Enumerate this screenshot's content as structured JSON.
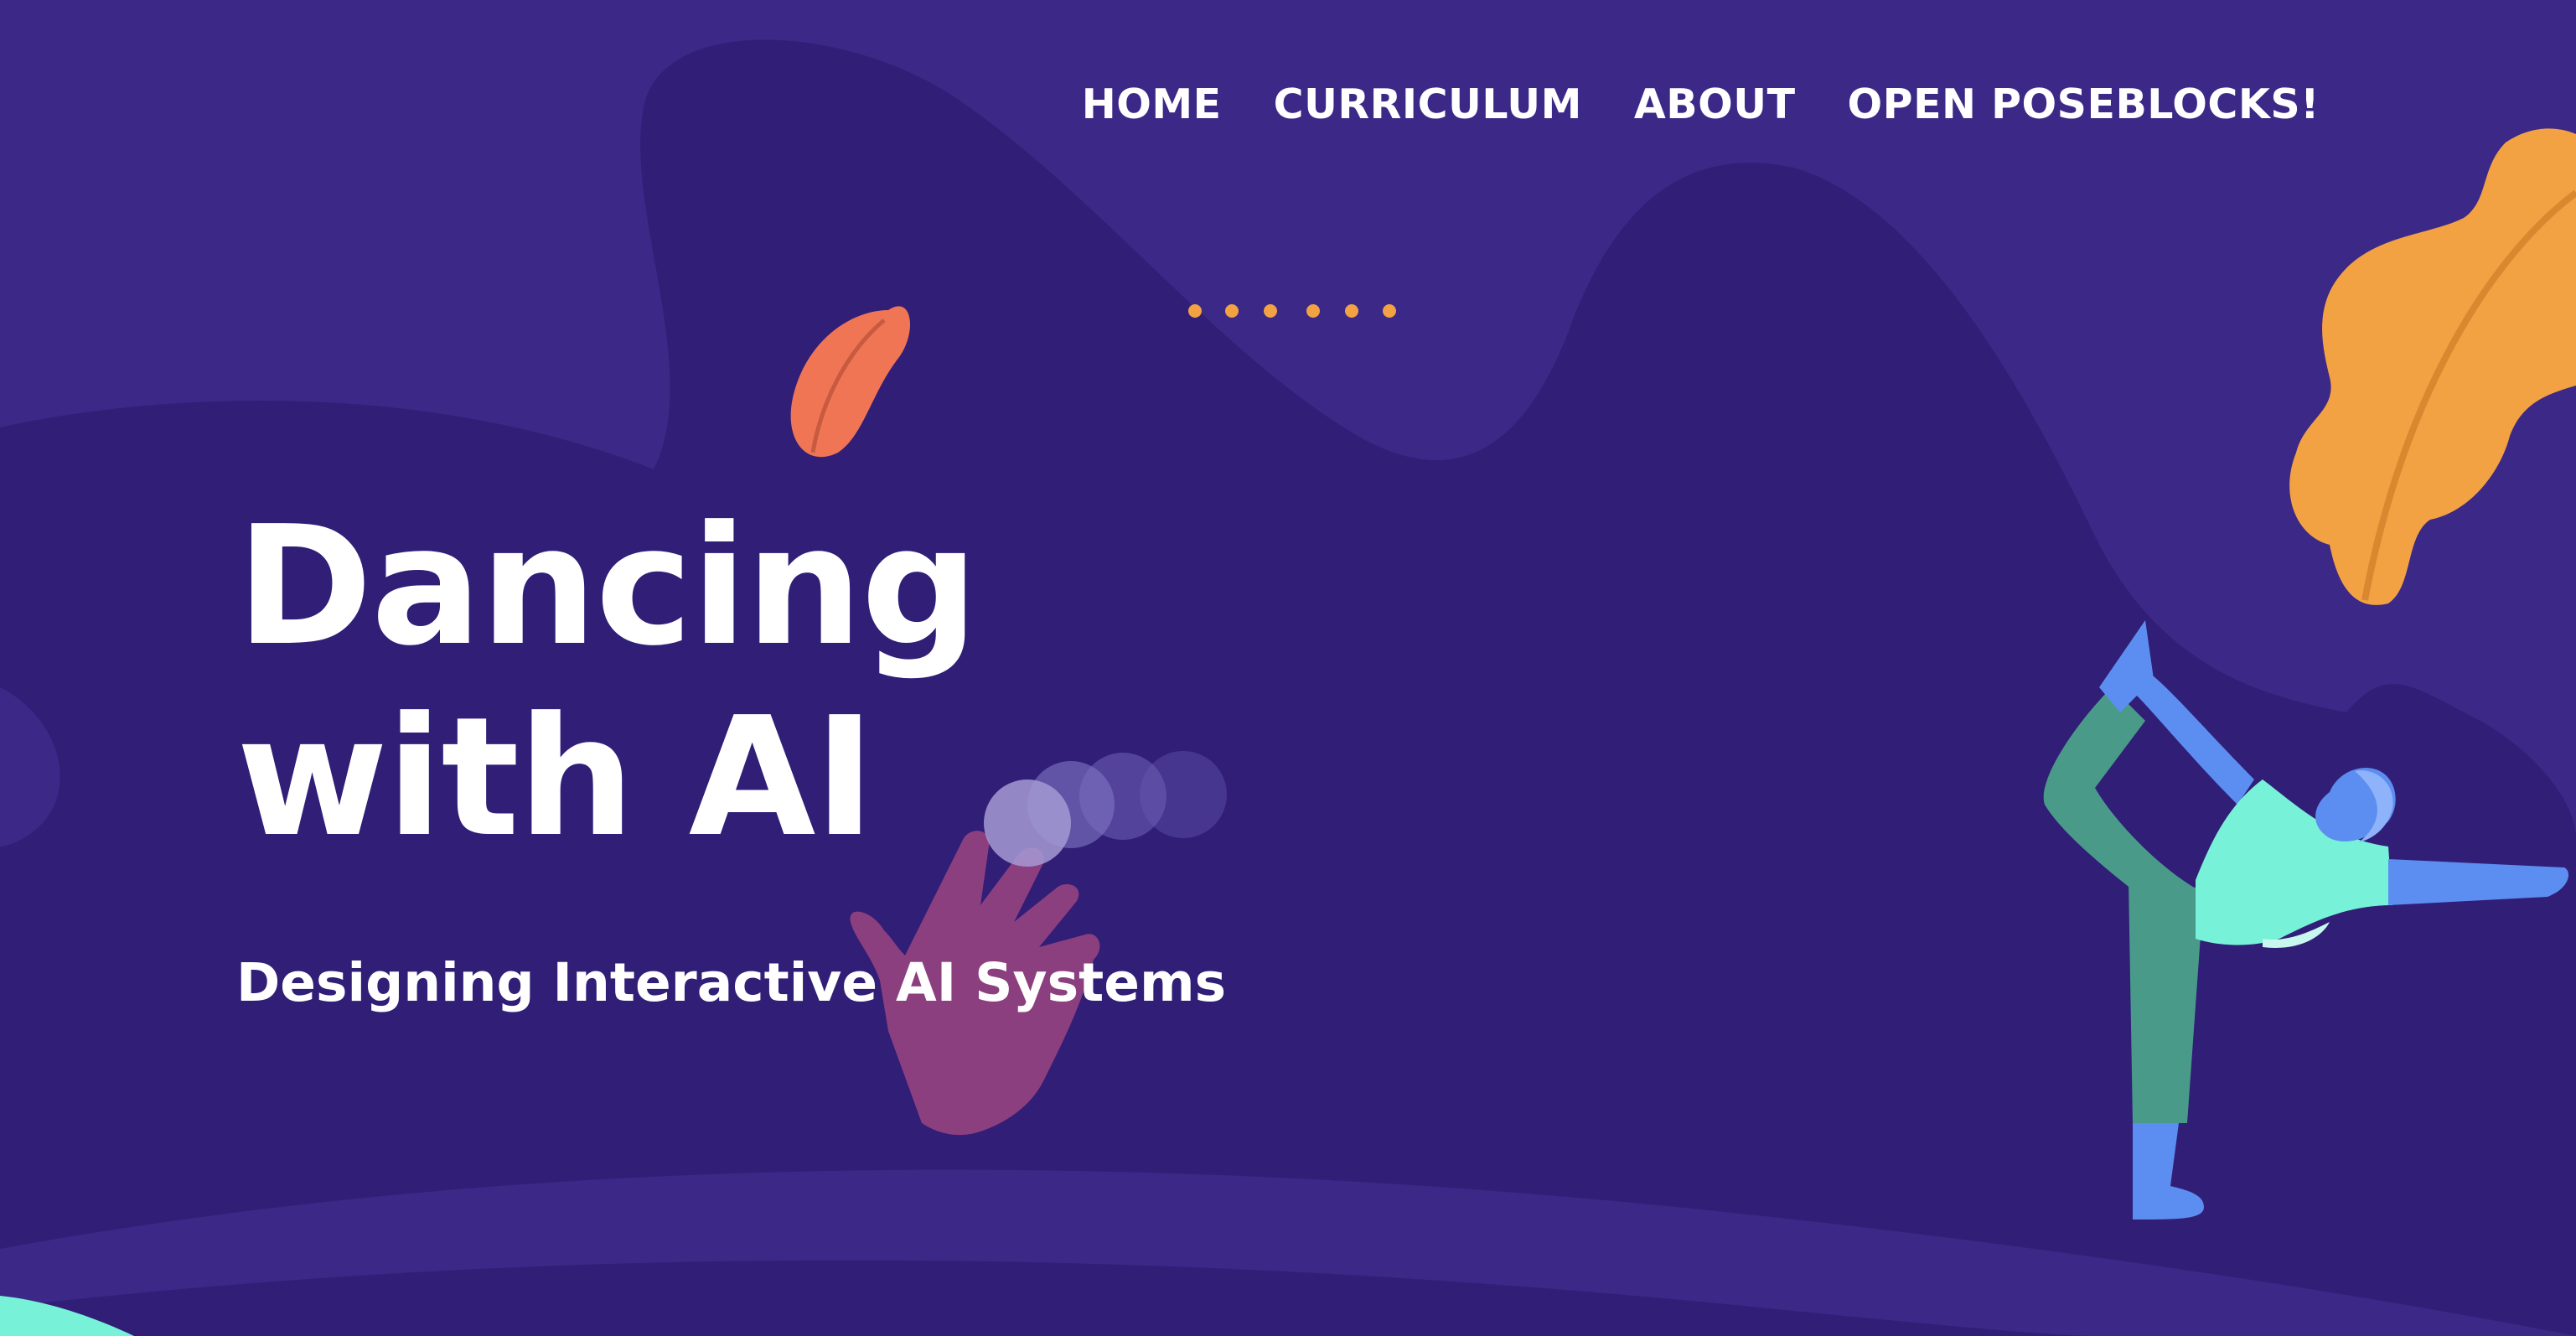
{
  "nav": {
    "items": [
      {
        "label": "HOME"
      },
      {
        "label": "CURRICULUM"
      },
      {
        "label": "ABOUT"
      },
      {
        "label": "OPEN POSEBLOCKS!"
      }
    ]
  },
  "hero": {
    "title_line1": "Dancing",
    "title_line2": "with AI",
    "subtitle": "Designing Interactive AI Systems"
  },
  "colors": {
    "background": "#3b2887",
    "blob_dark": "#301e77",
    "accent_orange": "#f2a243",
    "leaf_coral": "#ef7555",
    "hand_magenta": "#8c3f7f",
    "figure_teal": "#77f1d7",
    "figure_green": "#4a9a8a",
    "figure_blue": "#5b8ef0",
    "text": "#ffffff"
  },
  "illustrations": {
    "icons": [
      "orange-leaf-icon",
      "coral-leaf-icon",
      "hand-icon",
      "dancer-figure-icon",
      "motion-dots-icon"
    ]
  }
}
